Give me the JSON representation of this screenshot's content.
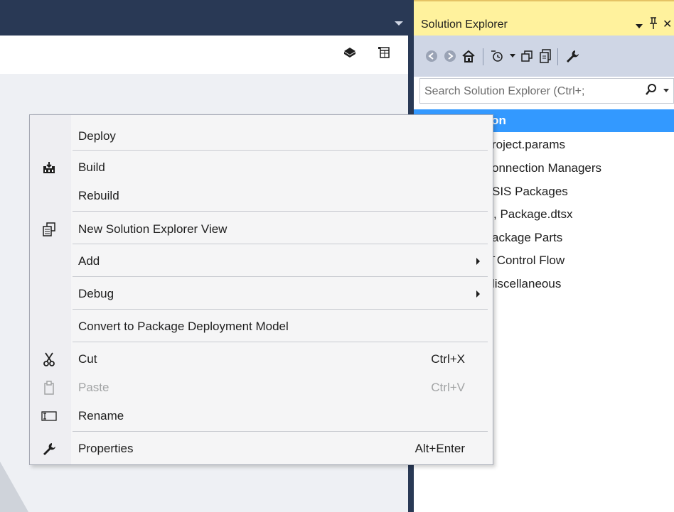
{
  "solution_explorer": {
    "title": "Solution Explorer",
    "pin_glyph": "▂̄",
    "close_glyph": "✕",
    "search_placeholder": "Search Solution Explorer (Ctrl+;",
    "tree": [
      {
        "label": "SSIMigration",
        "selected": true
      },
      {
        "label": "roject.params"
      },
      {
        "label": "onnection Managers"
      },
      {
        "label": "SIS Packages"
      },
      {
        "label": ", Package.dtsx"
      },
      {
        "label": "ackage Parts"
      },
      {
        "label": "̄ Control Flow"
      },
      {
        "label": "liscellaneous"
      }
    ]
  },
  "context_menu": {
    "items": {
      "deploy": {
        "label": "Deploy"
      },
      "build": {
        "label": "Build",
        "icon": "build-icon"
      },
      "rebuild": {
        "label": "Rebuild"
      },
      "new_view": {
        "label": "New Solution Explorer View",
        "icon": "new-view-icon"
      },
      "add": {
        "label": "Add"
      },
      "debug": {
        "label": "Debug"
      },
      "convert": {
        "label": "Convert to Package Deployment Model"
      },
      "cut": {
        "label": "Cut",
        "shortcut": "Ctrl+X",
        "icon": "scissors-icon"
      },
      "paste": {
        "label": "Paste",
        "shortcut": "Ctrl+V",
        "icon": "clipboard-icon",
        "disabled": true
      },
      "rename": {
        "label": "Rename",
        "icon": "rename-icon"
      },
      "properties": {
        "label": "Properties",
        "shortcut": "Alt+Enter",
        "icon": "wrench-icon"
      }
    }
  },
  "colors": {
    "title_dark": "#293955",
    "se_header": "#fff29d",
    "selection": "#3399ff",
    "menu_bg": "#f5f5f6"
  }
}
